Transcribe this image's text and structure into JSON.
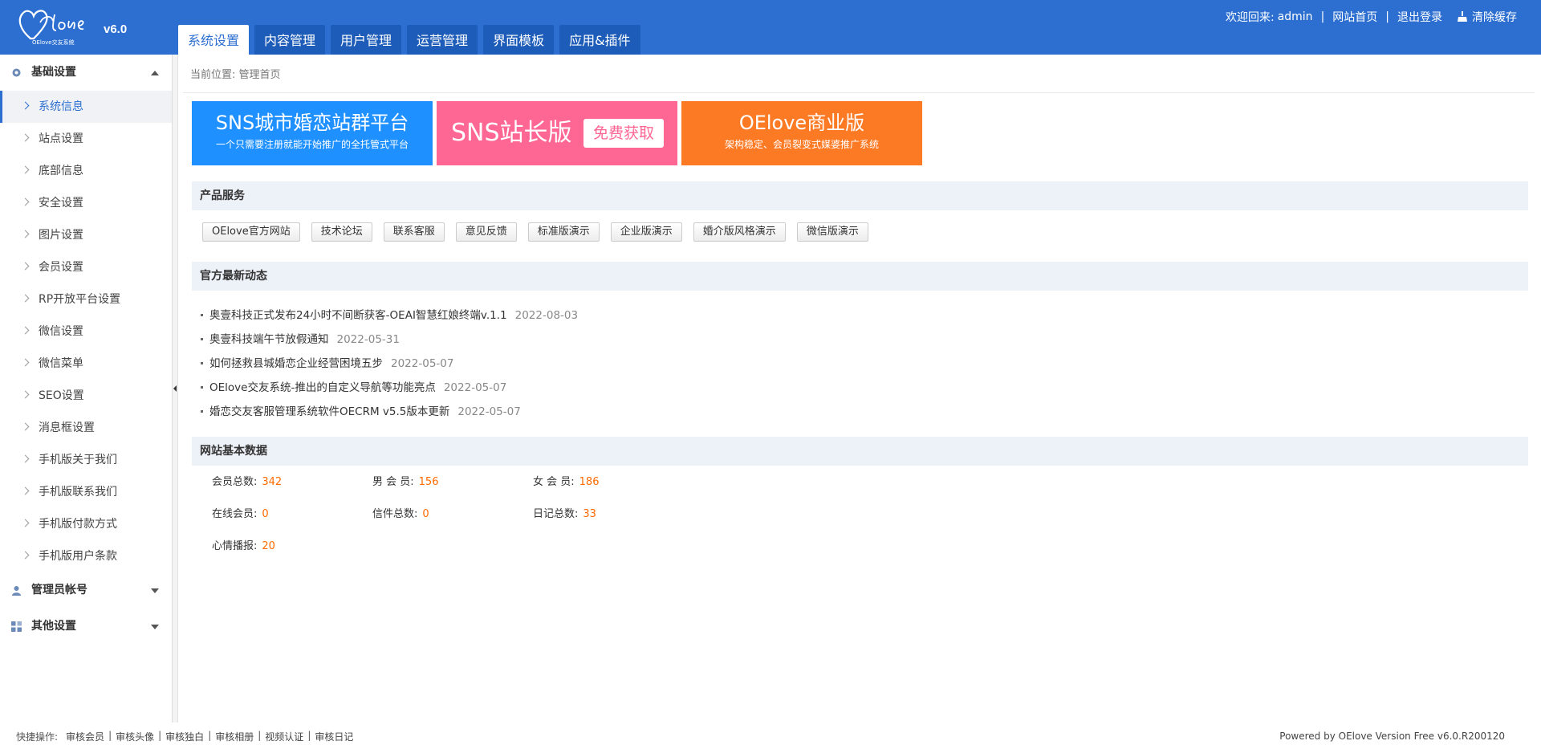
{
  "header": {
    "version": "v6.0",
    "welcome": "欢迎回来:",
    "username": "admin",
    "links": [
      "网站首页",
      "退出登录"
    ],
    "clear_cache": "清除缓存",
    "brand_color": "#2c6fd1",
    "logo_text": "OElove交友系统"
  },
  "tabs": [
    "系统设置",
    "内容管理",
    "用户管理",
    "运营管理",
    "界面模板",
    "应用&插件"
  ],
  "sidebar": {
    "groups": [
      {
        "label": "基础设置",
        "icon": "gear-icon",
        "expanded": true
      },
      {
        "label": "管理员帐号",
        "icon": "user-icon",
        "expanded": false
      },
      {
        "label": "其他设置",
        "icon": "grid-icon",
        "expanded": false
      }
    ],
    "items": [
      "系统信息",
      "站点设置",
      "底部信息",
      "安全设置",
      "图片设置",
      "会员设置",
      "RP开放平台设置",
      "微信设置",
      "微信菜单",
      "SEO设置",
      "消息框设置",
      "手机版关于我们",
      "手机版联系我们",
      "手机版付款方式",
      "手机版用户条款"
    ],
    "active_index": 0
  },
  "breadcrumb": "当前位置:  管理首页",
  "banners": [
    {
      "title": "SNS城市婚恋站群平台",
      "subtitle": "一个只需要注册就能开始推广的全托管式平台",
      "color": "#1e90ff"
    },
    {
      "title": "SNS站长版",
      "button": "免费获取",
      "color": "#fe6694"
    },
    {
      "title": "OElove商业版",
      "subtitle": "架构稳定、会员裂变式媒婆推广系统",
      "color": "#fd7a25"
    }
  ],
  "sections": {
    "products": "产品服务",
    "news": "官方最新动态",
    "stats": "网站基本数据"
  },
  "product_buttons": [
    "OElove官方网站",
    "技术论坛",
    "联系客服",
    "意见反馈",
    "标准版演示",
    "企业版演示",
    "婚介版风格演示",
    "微信版演示"
  ],
  "news": [
    {
      "title": "奥壹科技正式发布24小时不间断获客-OEAI智慧红娘终端v.1.1",
      "date": "2022-08-03"
    },
    {
      "title": "奥壹科技端午节放假通知",
      "date": "2022-05-31"
    },
    {
      "title": "如何拯救县城婚恋企业经营困境五步",
      "date": "2022-05-07"
    },
    {
      "title": "OElove交友系统-推出的自定义导航等功能亮点",
      "date": "2022-05-07"
    },
    {
      "title": "婚恋交友客服管理系统软件OECRM v5.5版本更新",
      "date": "2022-05-07"
    }
  ],
  "stats": [
    {
      "label": "会员总数:",
      "value": "342"
    },
    {
      "label": "男 会 员:",
      "value": "156"
    },
    {
      "label": "女 会 员:",
      "value": "186"
    },
    {
      "label": "在线会员:",
      "value": "0"
    },
    {
      "label": "信件总数:",
      "value": "0"
    },
    {
      "label": "日记总数:",
      "value": "33"
    },
    {
      "label": "心情播报:",
      "value": "20"
    }
  ],
  "footer": {
    "quick_label": "快捷操作:",
    "quick_links": [
      "审核会员",
      "审核头像",
      "审核独白",
      "审核相册",
      "视频认证",
      "审核日记"
    ],
    "powered": "Powered by OElove Version Free v6.0.R200120"
  }
}
